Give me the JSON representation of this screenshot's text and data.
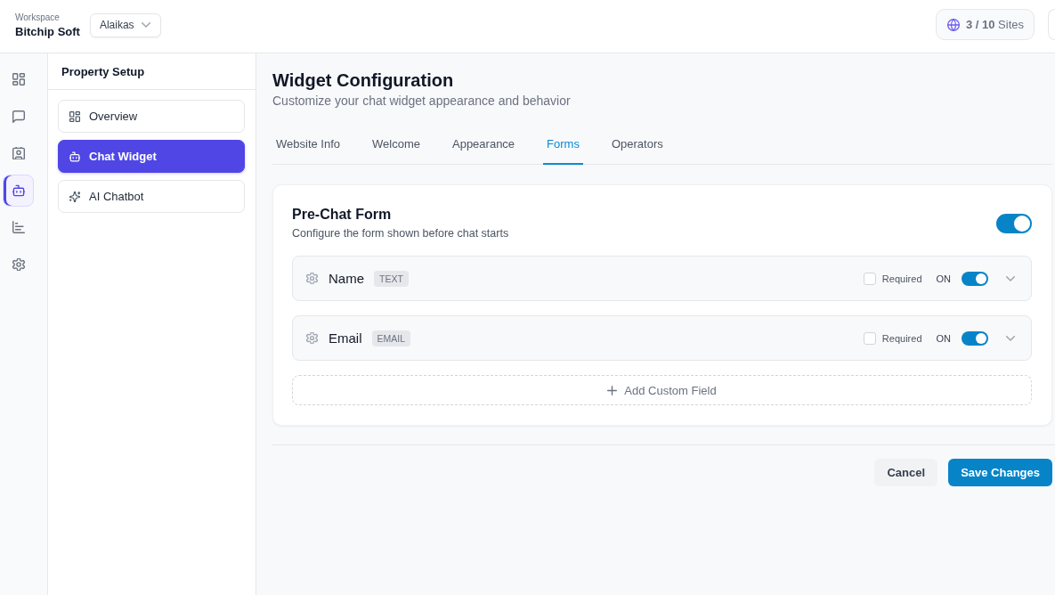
{
  "header": {
    "workspace_label": "Workspace",
    "workspace_name": "Bitchip Soft",
    "property_dropdown": {
      "value": "Alaikas"
    },
    "sites_usage": "**3 / 10** Sites"
  },
  "nav_rail": {
    "items": [
      {
        "kind": "dashboard",
        "selected": false
      },
      {
        "kind": "conversations",
        "selected": false
      },
      {
        "kind": "contacts",
        "selected": false
      },
      {
        "kind": "widget",
        "selected": true
      },
      {
        "kind": "analytics",
        "selected": false
      },
      {
        "kind": "settings",
        "selected": false
      }
    ]
  },
  "sidebar": {
    "title": "Property Setup",
    "items": [
      {
        "kind": "dashboard",
        "label": "Overview",
        "selected": false
      },
      {
        "kind": "widget",
        "label": "Chat Widget",
        "selected": true
      },
      {
        "kind": "ai",
        "label": "AI Chatbot",
        "selected": false
      }
    ]
  },
  "page": {
    "title": "Widget Configuration",
    "subtitle": "Customize your chat widget appearance and behavior"
  },
  "tabs": [
    {
      "label": "Website Info",
      "selected": false
    },
    {
      "label": "Welcome",
      "selected": false
    },
    {
      "label": "Appearance",
      "selected": false
    },
    {
      "label": "Forms",
      "selected": true
    },
    {
      "label": "Operators",
      "selected": false
    }
  ],
  "pre_chat_form": {
    "title": "Pre-Chat Form",
    "description": "Configure the form shown before chat starts",
    "enabled": true,
    "fields": [
      {
        "name": "Name",
        "type": "TEXT",
        "required": false,
        "required_label": "Required",
        "on": true,
        "on_label": "ON",
        "expanded": false
      },
      {
        "name": "Email",
        "type": "EMAIL",
        "required": false,
        "required_label": "Required",
        "on": true,
        "on_label": "ON",
        "expanded": false
      }
    ],
    "add_button": "Add Custom Field"
  },
  "actions": [
    {
      "kind": "secondary",
      "label": "Cancel"
    },
    {
      "kind": "primary",
      "label": "Save Changes"
    }
  ]
}
